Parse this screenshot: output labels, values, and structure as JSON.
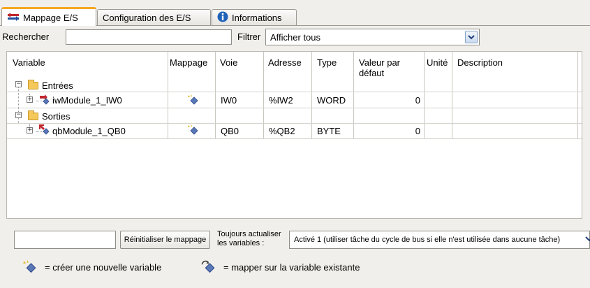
{
  "tabs": [
    {
      "label": "Mappage E/S",
      "icon": "io-mapping-icon"
    },
    {
      "label": "Configuration des E/S"
    },
    {
      "label": "Informations",
      "icon": "info-icon"
    }
  ],
  "search": {
    "label": "Rechercher",
    "value": ""
  },
  "filter": {
    "label": "Filtrer",
    "value": "Afficher tous"
  },
  "table": {
    "headers": {
      "variable": "Variable",
      "mapping": "Mappage",
      "channel": "Voie",
      "address": "Adresse",
      "type": "Type",
      "default": "Valeur par défaut",
      "unit": "Unité",
      "description": "Description"
    },
    "groups": [
      {
        "name": "Entrées",
        "row": {
          "variable": "iwModule_1_IW0",
          "channel": "IW0",
          "address": "%IW2",
          "type": "WORD",
          "default": "0",
          "unit": "",
          "description": ""
        }
      },
      {
        "name": "Sorties",
        "row": {
          "variable": "qbModule_1_QB0",
          "channel": "QB0",
          "address": "%QB2",
          "type": "BYTE",
          "default": "0",
          "unit": "",
          "description": ""
        }
      }
    ]
  },
  "bottom": {
    "reset_button": "Réinitialiser le mappage",
    "update_label": "Toujours actualiser les variables :",
    "update_value": "Activé 1 (utiliser tâche du cycle de bus si elle n'est utilisée dans aucune tâche)"
  },
  "legend": {
    "new_var": "= créer une nouvelle variable",
    "existing_var": "= mapper sur la variable existante"
  }
}
